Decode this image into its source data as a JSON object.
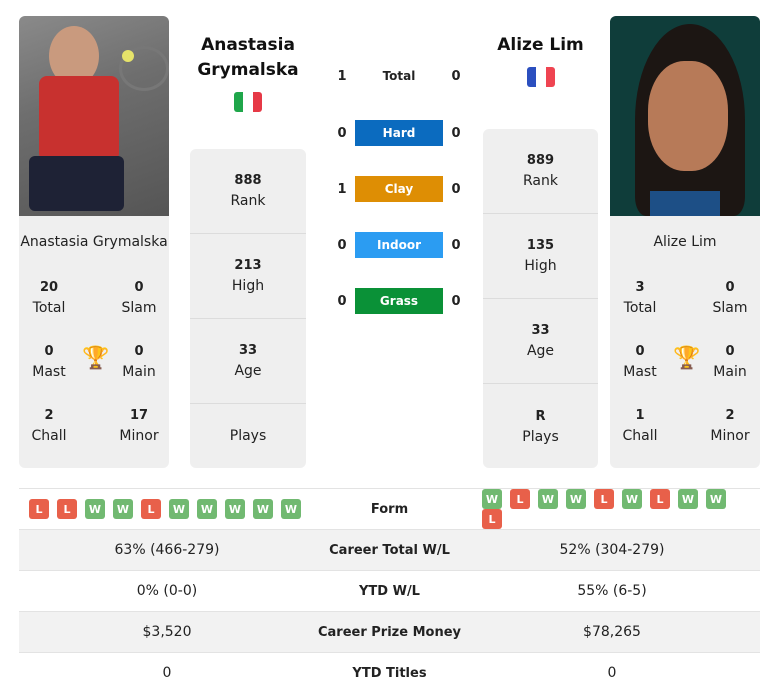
{
  "player1": {
    "name": "Anastasia Grymalska",
    "name_line1": "Anastasia",
    "name_line2": "Grymalska",
    "country_flag": "italy-flag",
    "flag_colors": [
      "#1fa64a",
      "#ffffff",
      "#e63946"
    ],
    "rank": "888",
    "rank_label": "Rank",
    "high": "213",
    "high_label": "High",
    "age": "33",
    "age_label": "Age",
    "plays": "",
    "plays_label": "Plays",
    "titles": {
      "total": "20",
      "total_label": "Total",
      "slam": "0",
      "slam_label": "Slam",
      "mast": "0",
      "mast_label": "Mast",
      "main": "0",
      "main_label": "Main",
      "chall": "2",
      "chall_label": "Chall",
      "minor": "17",
      "minor_label": "Minor"
    },
    "form": [
      "L",
      "L",
      "W",
      "W",
      "L",
      "W",
      "W",
      "W",
      "W",
      "W"
    ],
    "career_wl": "63% (466-279)",
    "ytd_wl": "0% (0-0)",
    "prize_money": "$3,520",
    "ytd_titles": "0"
  },
  "player2": {
    "name": "Alize Lim",
    "country_flag": "france-flag",
    "flag_colors": [
      "#2b4fbf",
      "#ffffff",
      "#ef4451"
    ],
    "rank": "889",
    "rank_label": "Rank",
    "high": "135",
    "high_label": "High",
    "age": "33",
    "age_label": "Age",
    "plays": "R",
    "plays_label": "Plays",
    "titles": {
      "total": "3",
      "total_label": "Total",
      "slam": "0",
      "slam_label": "Slam",
      "mast": "0",
      "mast_label": "Mast",
      "main": "0",
      "main_label": "Main",
      "chall": "1",
      "chall_label": "Chall",
      "minor": "2",
      "minor_label": "Minor"
    },
    "form": [
      "W",
      "L",
      "W",
      "W",
      "L",
      "W",
      "L",
      "W",
      "W",
      "L"
    ],
    "career_wl": "52% (304-279)",
    "ytd_wl": "55% (6-5)",
    "prize_money": "$78,265",
    "ytd_titles": "0"
  },
  "h2h": [
    {
      "label": "Total",
      "p1": "1",
      "p2": "0",
      "color": ""
    },
    {
      "label": "Hard",
      "p1": "0",
      "p2": "0",
      "color": "#0b6bbf"
    },
    {
      "label": "Clay",
      "p1": "1",
      "p2": "0",
      "color": "#de8e04"
    },
    {
      "label": "Indoor",
      "p1": "0",
      "p2": "0",
      "color": "#2b9cf2"
    },
    {
      "label": "Grass",
      "p1": "0",
      "p2": "0",
      "color": "#0a9137"
    }
  ],
  "rows": {
    "form": "Form",
    "career_wl": "Career Total W/L",
    "ytd_wl": "YTD W/L",
    "prize_money": "Career Prize Money",
    "ytd_titles": "YTD Titles"
  },
  "colors": {
    "win": "#71b971",
    "loss": "#e8604a"
  }
}
